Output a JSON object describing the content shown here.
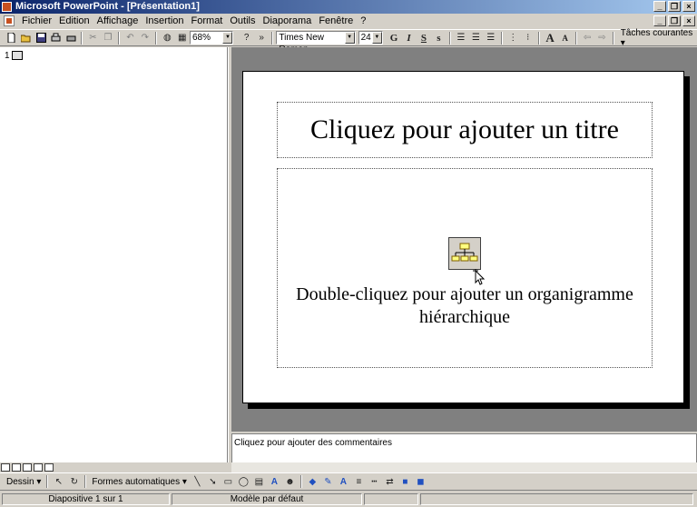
{
  "window": {
    "title": "Microsoft PowerPoint - [Présentation1]"
  },
  "menu": [
    "Fichier",
    "Edition",
    "Affichage",
    "Insertion",
    "Format",
    "Outils",
    "Diaporama",
    "Fenêtre",
    "?"
  ],
  "toolbar": {
    "zoom": "68%",
    "font_name": "Times New Roman",
    "font_size": "24",
    "bold": "G",
    "italic": "I",
    "underline": "S",
    "shadow": "s",
    "tasks": "Tâches courantes ▾"
  },
  "outline": {
    "slide_number": "1"
  },
  "slide": {
    "title_placeholder": "Cliquez pour ajouter un titre",
    "body_line1": "Double-cliquez pour ajouter un organigramme",
    "body_line2": "hiérarchique"
  },
  "notes": {
    "placeholder": "Cliquez pour ajouter des commentaires"
  },
  "drawing": {
    "dessin": "Dessin ▾",
    "formes": "Formes automatiques ▾"
  },
  "status": {
    "slide": "Diapositive 1 sur 1",
    "template": "Modèle par défaut"
  },
  "colors": {
    "title_start": "#0a246a",
    "title_end": "#a6caf0",
    "workspace": "#808080"
  }
}
